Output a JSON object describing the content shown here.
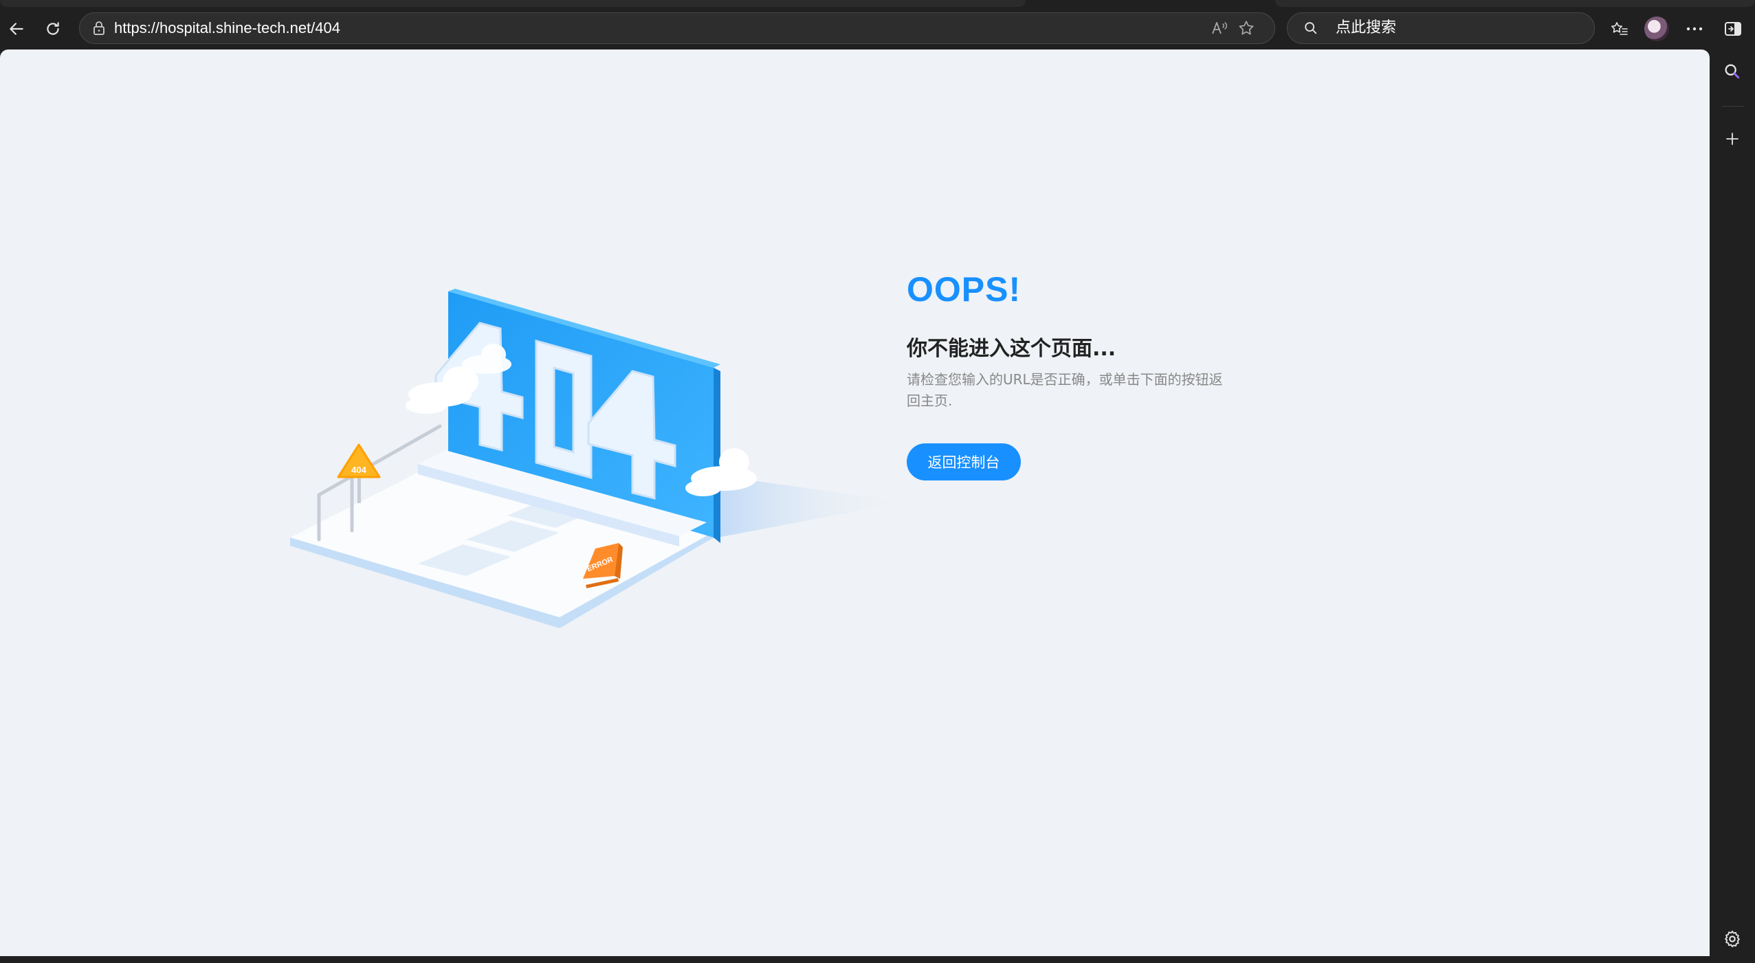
{
  "browser": {
    "url": "https://hospital.shine-tech.net/404",
    "search_placeholder": "点此搜索"
  },
  "page": {
    "oops": "OOPS!",
    "headline": "你不能进入这个页面...",
    "info": "请检查您输入的URL是否正确，或单击下面的按钮返回主页.",
    "button_label": "返回控制台",
    "illustration": {
      "board_text": "404",
      "sign_text": "404",
      "easel_text": "ERROR"
    }
  },
  "colors": {
    "accent": "#1890ff",
    "page_bg": "#eff2f6",
    "chrome_bg": "#202020"
  }
}
